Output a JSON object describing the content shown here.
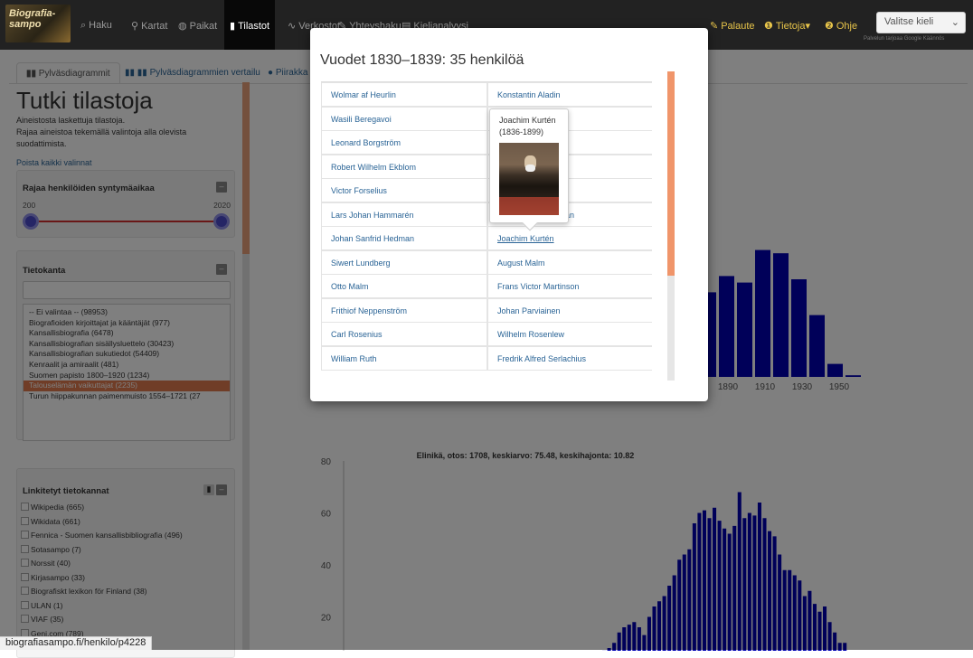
{
  "navbar": {
    "brand": "Biografia-sampo",
    "items": [
      {
        "label": "Haku",
        "icon": "search-icon",
        "glyph": "⌕"
      },
      {
        "label": "Kartat",
        "icon": "map-marker-icon",
        "glyph": "⚲"
      },
      {
        "label": "Paikat",
        "icon": "globe-icon",
        "glyph": "◍"
      },
      {
        "label": "Tilastot",
        "icon": "bar-chart-icon",
        "glyph": "▮"
      },
      {
        "label": "Verkostot",
        "icon": "network-icon",
        "glyph": "∿"
      },
      {
        "label": "Yhteyshaku",
        "icon": "pencil-icon",
        "glyph": "✎"
      },
      {
        "label": "Kielianalyysi",
        "icon": "document-icon",
        "glyph": "▤"
      }
    ],
    "right": [
      {
        "label": "Palaute",
        "icon": "pencil-icon",
        "glyph": "✎"
      },
      {
        "label": "Tietoja",
        "icon": "info-icon",
        "glyph": "❶"
      },
      {
        "label": "Ohje",
        "icon": "help-icon",
        "glyph": "❷"
      }
    ],
    "tietoja_caret": "▾",
    "language_select": "Valitse kieli",
    "google_translate": "Palvelun tarjoaa Google Käännös"
  },
  "tabs": [
    "Pylväsdiagrammit",
    "Pylväsdiagrammien vertailu",
    "Piirakka"
  ],
  "sidebar": {
    "title": "Tutki tilastoja",
    "description": [
      "Aineistosta laskettuja tilastoja.",
      "Rajaa aineistoa tekemällä valintoja alla olevista",
      "suodattimista."
    ],
    "clear_all": "Poista kaikki valinnat",
    "birth_filter": {
      "title": "Rajaa henkilöiden syntymäaikaa",
      "min": "200",
      "max": "2020"
    },
    "database_panel": {
      "title": "Tietokanta",
      "items": [
        "-- Ei valintaa -- (98953)",
        "Biografioiden kirjoittajat ja kääntäjät (977)",
        "Kansallisbiografia (6478)",
        "Kansallisbiografian sisällysluettelo (30423)",
        "Kansallisbiografian sukutiedot (54409)",
        "Kenraalit ja amiraalit (481)",
        "Suomen papisto 1800–1920 (1234)",
        "Talouselämän vaikuttajat (2235)",
        "Turun hiippakunnan paimenmuisto 1554–1721 (27"
      ],
      "selected_index": 7
    },
    "linked_panel": {
      "title": "Linkitetyt tietokannat",
      "items": [
        "Wikipedia (665)",
        "Wikidata (661)",
        "Fennica - Suomen kansallisbibliografia (496)",
        "Sotasampo (7)",
        "Norssit (40)",
        "Kirjasampo (33)",
        "Biografiskt lexikon för Finland (38)",
        "ULAN (1)",
        "VIAF (35)",
        "Geni.com (789)"
      ]
    }
  },
  "modal": {
    "title": "Vuodet 1830–1839: 35 henkilöä",
    "left_col": [
      "Wolmar af Heurlin",
      "Wasili Beregavoi",
      "Leonard Borgström",
      "Robert Wilhelm Ekblom",
      "Victor Forselius",
      "Lars Johan Hammarén",
      "Johan Sanfrid Hedman",
      "Siwert Lundberg",
      "Otto Malm",
      "Frithiof Neppenström",
      "Carl Rosenius",
      "William Ruth"
    ],
    "right_col": [
      "Konstantin Aladin",
      "",
      "",
      "",
      "",
      "an",
      "Joachim Kurtén",
      "August Malm",
      "Frans Victor Martinson",
      "Johan Parviainen",
      "Wilhelm Rosenlew",
      "Fredrik Alfred Serlachius"
    ],
    "tooltip": {
      "name": "Joachim Kurtén",
      "years": "(1836-1899)"
    }
  },
  "status_url": "biografiasampo.fi/henkilo/p4228",
  "chart_data": [
    {
      "type": "bar",
      "title": "",
      "xlabel": "",
      "ylabel": "",
      "x_tick_labels": [
        "1890",
        "1910",
        "1930",
        "1950"
      ],
      "note": "partially hidden behind modal; visible bars from ~1870 to ~1950",
      "x": [
        1870,
        1880,
        1890,
        1900,
        1910,
        1920,
        1930,
        1940,
        1950
      ],
      "values": [
        0.52,
        0.62,
        0.58,
        0.78,
        0.76,
        0.6,
        0.38,
        0.08,
        0.01
      ],
      "value_scale": "relative"
    },
    {
      "type": "bar",
      "title": "Elinikä, otos: 1708, keskiarvo: 75.48, keskihajonta: 10.82",
      "xlabel": "",
      "ylabel": "",
      "xlim": [
        0,
        101
      ],
      "ylim": [
        0,
        80
      ],
      "x_ticks": [
        10,
        20,
        30,
        40,
        50,
        60,
        70,
        80,
        90,
        100
      ],
      "y_ticks": [
        20,
        40,
        60,
        80
      ],
      "x": [
        41,
        45,
        47,
        48,
        49,
        50,
        51,
        52,
        53,
        54,
        55,
        56,
        57,
        58,
        59,
        60,
        61,
        62,
        63,
        64,
        65,
        66,
        67,
        68,
        69,
        70,
        71,
        72,
        73,
        74,
        75,
        76,
        77,
        78,
        79,
        80,
        81,
        82,
        83,
        84,
        85,
        86,
        87,
        88,
        89,
        90,
        91,
        92,
        93,
        94,
        95,
        96,
        97,
        98,
        99,
        100
      ],
      "values": [
        1,
        2,
        2,
        3,
        3,
        4,
        5,
        7,
        8,
        10,
        14,
        16,
        17,
        18,
        16,
        13,
        20,
        24,
        26,
        28,
        32,
        36,
        42,
        44,
        46,
        56,
        60,
        61,
        58,
        62,
        57,
        54,
        52,
        55,
        68,
        58,
        60,
        59,
        64,
        58,
        53,
        51,
        44,
        38,
        38,
        36,
        34,
        28,
        30,
        25,
        22,
        24,
        18,
        14,
        10,
        10
      ]
    }
  ]
}
